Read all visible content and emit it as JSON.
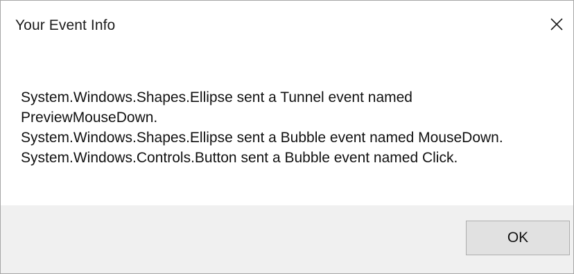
{
  "window": {
    "title": "Your Event Info",
    "close_icon": "close-icon"
  },
  "message": {
    "lines": [
      "System.Windows.Shapes.Ellipse sent a Tunnel event named",
      "PreviewMouseDown.",
      "System.Windows.Shapes.Ellipse sent a Bubble event named MouseDown.",
      "System.Windows.Controls.Button sent a Bubble event named Click."
    ]
  },
  "buttons": {
    "ok_label": "OK"
  },
  "colors": {
    "footer_background": "#f0f0f0",
    "button_background": "#e1e1e1",
    "button_border": "#adadad"
  }
}
